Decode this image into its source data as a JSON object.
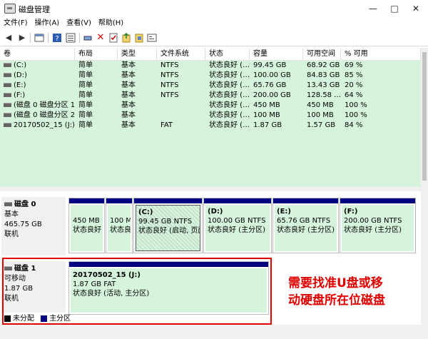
{
  "window": {
    "title": "磁盘管理",
    "minimize": "—",
    "maximize": "□",
    "close": "✕"
  },
  "menu": [
    "文件(F)",
    "操作(A)",
    "查看(V)",
    "帮助(H)"
  ],
  "toolbar": {
    "icons": [
      "back-icon",
      "forward-icon",
      "properties-icon",
      "help-icon",
      "refresh-icon",
      "connect-icon",
      "delete-icon",
      "check-icon",
      "export-icon",
      "settings-icon",
      "list-icon"
    ]
  },
  "table": {
    "headers": [
      "卷",
      "布局",
      "类型",
      "文件系统",
      "状态",
      "容量",
      "可用空间",
      "% 可用"
    ],
    "rows": [
      [
        "(C:)",
        "简单",
        "基本",
        "NTFS",
        "状态良好 (…",
        "99.45 GB",
        "68.92 GB",
        "69 %"
      ],
      [
        "(D:)",
        "简单",
        "基本",
        "NTFS",
        "状态良好 (…",
        "100.00 GB",
        "84.83 GB",
        "85 %"
      ],
      [
        "(E:)",
        "简单",
        "基本",
        "NTFS",
        "状态良好 (…",
        "65.76 GB",
        "13.43 GB",
        "20 %"
      ],
      [
        "(F:)",
        "简单",
        "基本",
        "NTFS",
        "状态良好 (…",
        "200.00 GB",
        "128.58 …",
        "64 %"
      ],
      [
        "(磁盘 0 磁盘分区 1)",
        "简单",
        "基本",
        "",
        "状态良好 (…",
        "450 MB",
        "450 MB",
        "100 %"
      ],
      [
        "(磁盘 0 磁盘分区 2)",
        "简单",
        "基本",
        "",
        "状态良好 (…",
        "100 MB",
        "100 MB",
        "100 %"
      ],
      [
        "20170502_15 (J:)",
        "简单",
        "基本",
        "FAT",
        "状态良好 (…",
        "1.87 GB",
        "1.57 GB",
        "84 %"
      ]
    ]
  },
  "disk0": {
    "name": "磁盘 0",
    "type": "基本",
    "size": "465.75 GB",
    "status": "联机",
    "volumes": [
      {
        "title": "",
        "line1": "450 MB",
        "line2": "状态良好"
      },
      {
        "title": "",
        "line1": "100 M",
        "line2": "状态良"
      },
      {
        "title": "(C:)",
        "line1": "99.45 GB NTFS",
        "line2": "状态良好 (启动, 页面"
      },
      {
        "title": "(D:)",
        "line1": "100.00 GB NTFS",
        "line2": "状态良好 (主分区)"
      },
      {
        "title": "(E:)",
        "line1": "65.76 GB NTFS",
        "line2": "状态良好 (主分区)"
      },
      {
        "title": "(F:)",
        "line1": "200.00 GB NTFS",
        "line2": "状态良好 (主分区)"
      }
    ]
  },
  "disk1": {
    "name": "磁盘 1",
    "type": "可移动",
    "size": "1.87 GB",
    "status": "联机",
    "volume": {
      "title": "20170502_15   (J:)",
      "line1": "1.87 GB FAT",
      "line2": "状态良好 (活动, 主分区)"
    }
  },
  "legend": [
    {
      "label": "未分配",
      "color": "#000000"
    },
    {
      "label": "主分区",
      "color": "#000080"
    }
  ],
  "annotation": {
    "line1": "需要找准U盘或移",
    "line2": "动硬盘所在位磁盘",
    "color": "#e00000"
  }
}
